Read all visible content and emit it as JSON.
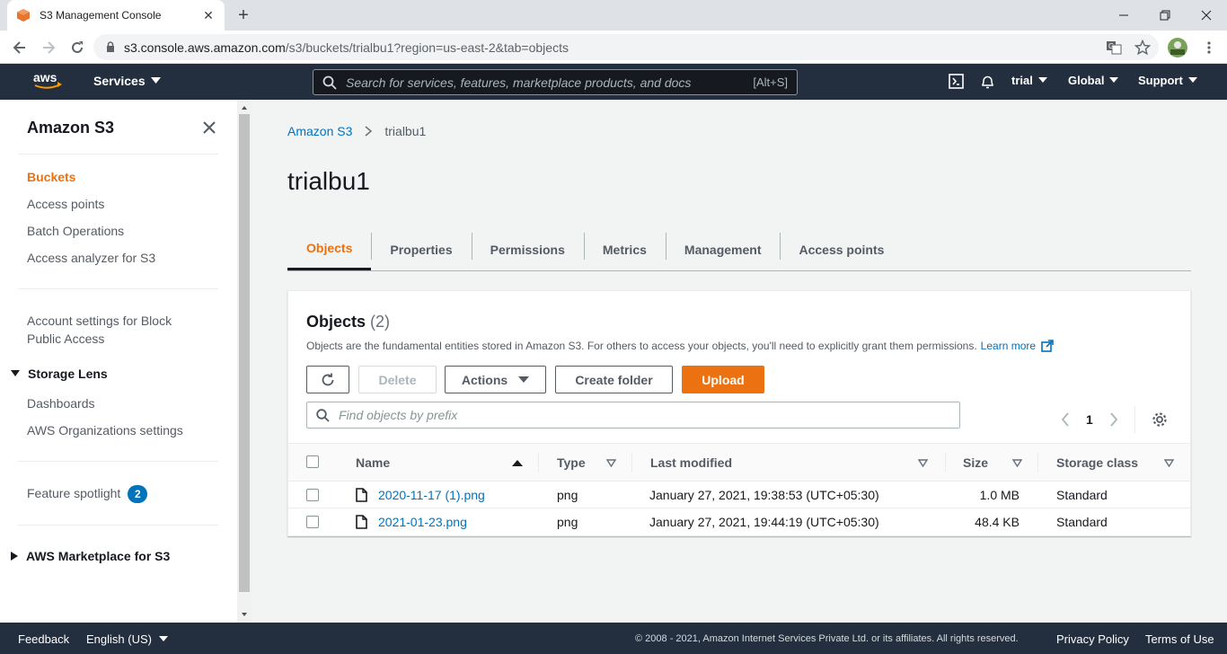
{
  "browser": {
    "tab_title": "S3 Management Console",
    "new_tab": "+",
    "url_host": "s3.console.aws.amazon.com",
    "url_path": "/s3/buckets/trialbu1?region=us-east-2&tab=objects"
  },
  "aws_header": {
    "services_label": "Services",
    "search_placeholder": "Search for services, features, marketplace products, and docs",
    "search_shortcut": "[Alt+S]",
    "account": "trial",
    "region": "Global",
    "support": "Support"
  },
  "sidebar": {
    "title": "Amazon S3",
    "items": [
      "Buckets",
      "Access points",
      "Batch Operations",
      "Access analyzer for S3"
    ],
    "account_settings": "Account settings for Block Public Access",
    "storage_lens": {
      "label": "Storage Lens",
      "items": [
        "Dashboards",
        "AWS Organizations settings"
      ]
    },
    "feature_spotlight": "Feature spotlight",
    "feature_spotlight_count": "2",
    "marketplace": "AWS Marketplace for S3"
  },
  "breadcrumb": {
    "root": "Amazon S3",
    "current": "trialbu1"
  },
  "page_title": "trialbu1",
  "tabs": [
    "Objects",
    "Properties",
    "Permissions",
    "Metrics",
    "Management",
    "Access points"
  ],
  "objects_panel": {
    "title": "Objects",
    "count": "(2)",
    "description": "Objects are the fundamental entities stored in Amazon S3. For others to access your objects, you'll need to explicitly grant them permissions.",
    "learn_more": "Learn more",
    "buttons": {
      "delete": "Delete",
      "actions": "Actions",
      "create_folder": "Create folder",
      "upload": "Upload"
    },
    "filter_placeholder": "Find objects by prefix",
    "page": "1",
    "columns": [
      "Name",
      "Type",
      "Last modified",
      "Size",
      "Storage class"
    ],
    "rows": [
      {
        "name": "2020-11-17 (1).png",
        "type": "png",
        "last_modified": "January 27, 2021, 19:38:53 (UTC+05:30)",
        "size": "1.0 MB",
        "storage_class": "Standard"
      },
      {
        "name": "2021-01-23.png",
        "type": "png",
        "last_modified": "January 27, 2021, 19:44:19 (UTC+05:30)",
        "size": "48.4 KB",
        "storage_class": "Standard"
      }
    ]
  },
  "footer": {
    "feedback": "Feedback",
    "language": "English (US)",
    "copyright": "© 2008 - 2021, Amazon Internet Services Private Ltd. or its affiliates. All rights reserved.",
    "privacy": "Privacy Policy",
    "terms": "Terms of Use"
  },
  "colors": {
    "accent": "#ec7211",
    "link": "#0073bb",
    "header_bg": "#232f3e"
  }
}
